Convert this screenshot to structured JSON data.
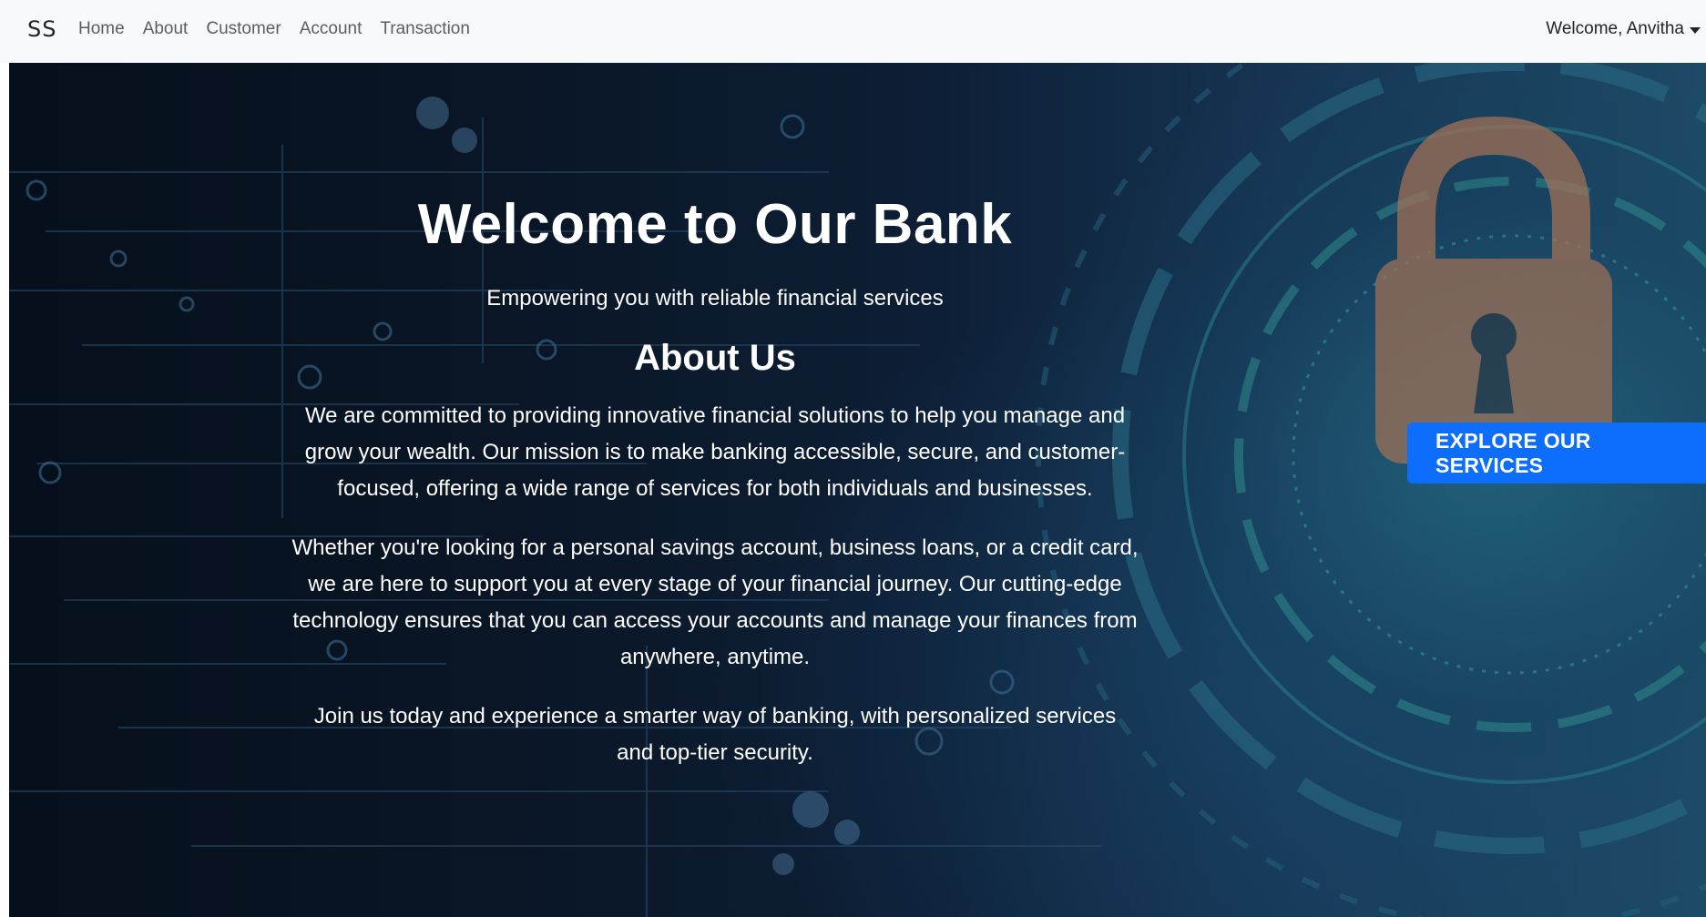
{
  "navbar": {
    "brand": "SS",
    "links": [
      "Home",
      "About",
      "Customer",
      "Account",
      "Transaction"
    ],
    "user_label": "Welcome, Anvitha"
  },
  "hero": {
    "title": "Welcome to Our Bank",
    "subtitle": "Empowering you with reliable financial services",
    "about_heading": "About Us",
    "paragraphs": [
      "We are committed to providing innovative financial solutions to help you manage and grow your wealth. Our mission is to make banking accessible, secure, and customer-focused, offering a wide range of services for both individuals and businesses.",
      "Whether you're looking for a personal savings account, business loans, or a credit card, we are here to support you at every stage of your financial journey. Our cutting-edge technology ensures that you can access your accounts and manage your finances from anywhere, anytime.",
      "Join us today and experience a smarter way of banking, with personalized services and top-tier security."
    ],
    "cta_label": "EXPLORE OUR SERVICES"
  },
  "colors": {
    "navbar_bg": "#f8f9fa",
    "cta_bg": "#0d6efd",
    "hero_text": "#ffffff"
  }
}
